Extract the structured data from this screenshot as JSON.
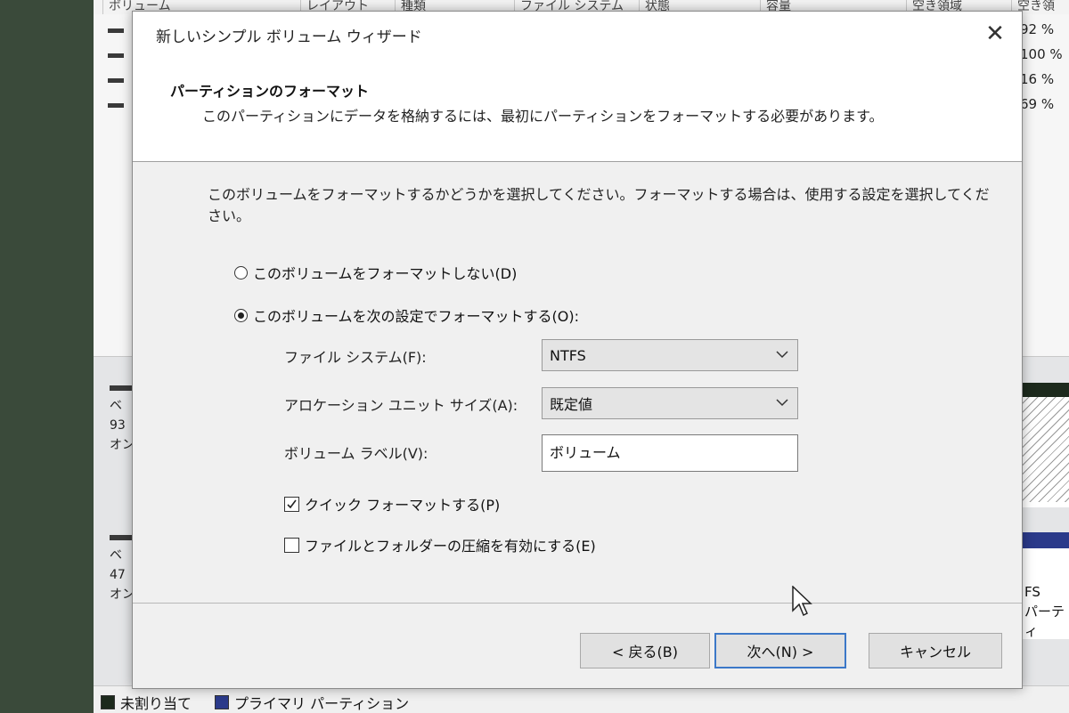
{
  "background": {
    "headers": [
      "ボリューム",
      "レイアウト",
      "種類",
      "ファイル システム",
      "状態",
      "容量",
      "空き領域",
      "空き領"
    ],
    "rows": [
      {
        "pct": "92 %"
      },
      {
        "pct": "100 %"
      },
      {
        "pct": "16 %"
      },
      {
        "pct": "69 %"
      }
    ],
    "disk1": {
      "line1": "ベ",
      "line2": "93",
      "line3": "オン"
    },
    "disk2": {
      "line1": "ベ",
      "line2": "47",
      "line3": "オン"
    },
    "right_panel": {
      "line1": "FS",
      "line2": "パーティ"
    },
    "legend": [
      {
        "label": "未割り当て",
        "color": "#1d2a1d"
      },
      {
        "label": "プライマリ パーティション",
        "color": "#2b3a8a"
      }
    ]
  },
  "dialog": {
    "title": "新しいシンプル ボリューム ウィザード",
    "close_glyph": "✕",
    "header_title": "パーティションのフォーマット",
    "header_subtitle": "このパーティションにデータを格納するには、最初にパーティションをフォーマットする必要があります。",
    "instruction": "このボリュームをフォーマットするかどうかを選択してください。フォーマットする場合は、使用する設定を選択してください。",
    "radio_no_format": "このボリュームをフォーマットしない(D)",
    "radio_format": "このボリュームを次の設定でフォーマットする(O):",
    "fs_label": "ファイル システム(F):",
    "fs_value": "NTFS",
    "alloc_label": "アロケーション ユニット サイズ(A):",
    "alloc_value": "既定値",
    "vol_label_label": "ボリューム ラベル(V):",
    "vol_label_value": "ボリューム",
    "quick_format": "クイック フォーマットする(P)",
    "compression": "ファイルとフォルダーの圧縮を有効にする(E)",
    "back_button": "< 戻る(B)",
    "next_button": "次へ(N) >",
    "cancel_button": "キャンセル"
  }
}
